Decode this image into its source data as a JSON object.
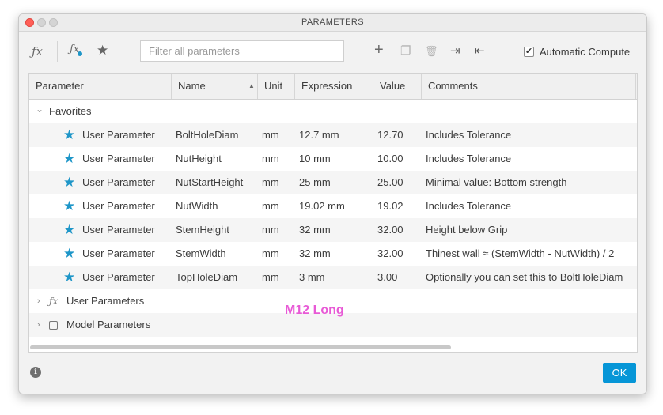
{
  "window": {
    "title": "PARAMETERS"
  },
  "toolbar": {
    "fx_icon": "ƒx",
    "fx_user_icon": "ƒx",
    "star_icon": "★",
    "filter_placeholder": "Filter all parameters",
    "add_icon": "+",
    "copy_icon": "❐",
    "delete_icon": "🗑",
    "import_icon": "⇥",
    "export_icon": "⇤",
    "auto_compute_label": "Automatic Compute",
    "auto_compute_checked": "✔"
  },
  "columns": [
    "Parameter",
    "Name",
    "Unit",
    "Expression",
    "Value",
    "Comments"
  ],
  "sort_icon": "▲",
  "groups": {
    "favorites": {
      "label": "Favorites",
      "chevron": "⌄"
    },
    "user": {
      "label": "User Parameters",
      "chevron": "›",
      "icon": "ƒx"
    },
    "model": {
      "label": "Model Parameters",
      "chevron": "›"
    }
  },
  "rows": [
    {
      "parameter": "User Parameter",
      "name": "BoltHoleDiam",
      "unit": "mm",
      "expression": "12.7 mm",
      "value": "12.70",
      "comment": "Includes Tolerance"
    },
    {
      "parameter": "User Parameter",
      "name": "NutHeight",
      "unit": "mm",
      "expression": "10 mm",
      "value": "10.00",
      "comment": "Includes Tolerance"
    },
    {
      "parameter": "User Parameter",
      "name": "NutStartHeight",
      "unit": "mm",
      "expression": "25 mm",
      "value": "25.00",
      "comment": "Minimal value: Bottom strength"
    },
    {
      "parameter": "User Parameter",
      "name": "NutWidth",
      "unit": "mm",
      "expression": "19.02 mm",
      "value": "19.02",
      "comment": "Includes Tolerance"
    },
    {
      "parameter": "User Parameter",
      "name": "StemHeight",
      "unit": "mm",
      "expression": "32 mm",
      "value": "32.00",
      "comment": "Height below Grip"
    },
    {
      "parameter": "User Parameter",
      "name": "StemWidth",
      "unit": "mm",
      "expression": "32 mm",
      "value": "32.00",
      "comment": "Thinest wall ≈ (StemWidth - NutWidth) / 2"
    },
    {
      "parameter": "User Parameter",
      "name": "TopHoleDiam",
      "unit": "mm",
      "expression": "3 mm",
      "value": "3.00",
      "comment": "Optionally you can set this to BoltHoleDiam"
    }
  ],
  "star": "★",
  "overlay": {
    "text": "M12 Long",
    "color": "#e85ad6"
  },
  "footer": {
    "info_icon": "i",
    "ok_label": "OK"
  },
  "colors": {
    "accent": "#0696d7",
    "star": "#1e96c8"
  }
}
